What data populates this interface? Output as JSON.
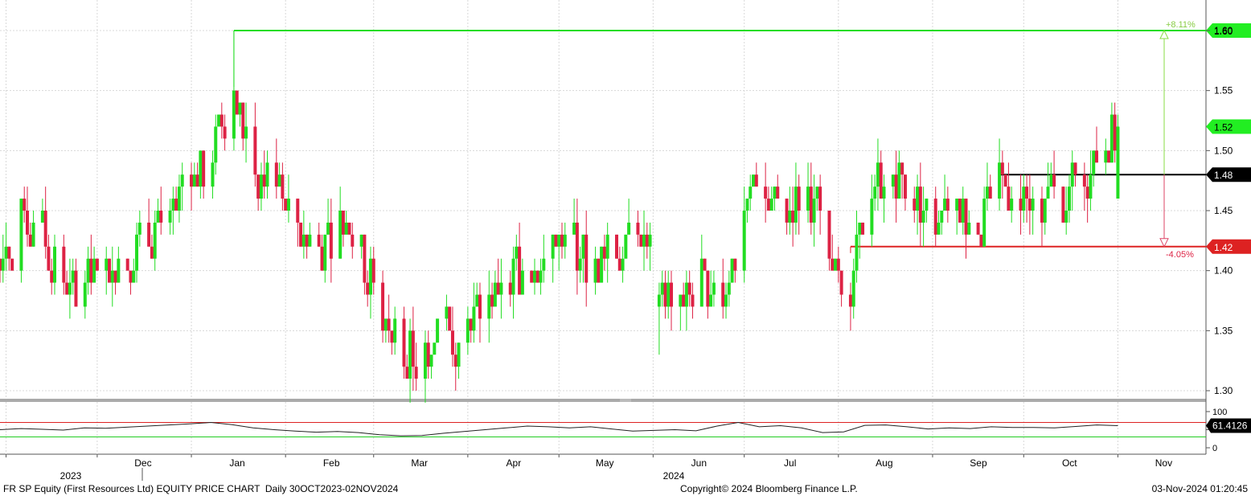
{
  "footer": {
    "left": "FR SP Equity (First Resources Ltd) EQUITY PRICE CHART  Daily 30OCT2023-02NOV2024",
    "center": "Copyright© 2024 Bloomberg Finance L.P.",
    "right": "03-Nov-2024 01:20:45"
  },
  "colors": {
    "up": "#22dd22",
    "down": "#dd2244",
    "grid": "#d8d8d8",
    "resistance": "#22dd22",
    "support": "#dd2222",
    "current": "#000000"
  },
  "chart_data": [
    {
      "type": "candlestick",
      "ylim": [
        1.29,
        1.62
      ],
      "yticks": [
        "1.30",
        "1.35",
        "1.40",
        "1.45",
        "1.50",
        "1.55",
        "1.60"
      ],
      "x_months": [
        "Dec",
        "Jan",
        "Feb",
        "Mar",
        "Apr",
        "May",
        "Jun",
        "Jul",
        "Aug",
        "Sep",
        "Oct",
        "Nov"
      ],
      "x_years": [
        "2023",
        "2024"
      ],
      "levels": [
        {
          "label": "1.60",
          "value": 1.6,
          "start": "2024-01-15",
          "color": "green"
        },
        {
          "label": "1.52",
          "value": 1.52,
          "color": "green"
        },
        {
          "label": "1.48",
          "value": 1.48,
          "start": "2024-09-23",
          "color": "black"
        },
        {
          "label": "1.42",
          "value": 1.42,
          "start": "2024-08-05",
          "color": "red"
        }
      ],
      "annotations": [
        {
          "text": "+8.11%",
          "value": 1.6,
          "color": "green"
        },
        {
          "text": "-4.05%",
          "value": 1.42,
          "color": "red"
        }
      ],
      "close_path": [
        [
          "2023-10-30",
          1.41
        ],
        [
          "2023-11-06",
          1.44
        ],
        [
          "2023-11-13",
          1.42
        ],
        [
          "2023-11-20",
          1.39
        ],
        [
          "2023-11-27",
          1.39
        ],
        [
          "2023-12-04",
          1.4
        ],
        [
          "2023-12-11",
          1.41
        ],
        [
          "2023-12-18",
          1.43
        ],
        [
          "2023-12-25",
          1.44
        ],
        [
          "2024-01-01",
          1.47
        ],
        [
          "2024-01-08",
          1.5
        ],
        [
          "2024-01-15",
          1.55
        ],
        [
          "2024-01-22",
          1.48
        ],
        [
          "2024-01-29",
          1.48
        ],
        [
          "2024-02-05",
          1.43
        ],
        [
          "2024-02-12",
          1.42
        ],
        [
          "2024-02-19",
          1.44
        ],
        [
          "2024-02-26",
          1.42
        ],
        [
          "2024-03-04",
          1.36
        ],
        [
          "2024-03-11",
          1.34
        ],
        [
          "2024-03-18",
          1.33
        ],
        [
          "2024-03-25",
          1.35
        ],
        [
          "2024-04-01",
          1.36
        ],
        [
          "2024-04-08",
          1.38
        ],
        [
          "2024-04-15",
          1.39
        ],
        [
          "2024-04-22",
          1.41
        ],
        [
          "2024-04-29",
          1.43
        ],
        [
          "2024-05-06",
          1.42
        ],
        [
          "2024-05-13",
          1.4
        ],
        [
          "2024-05-20",
          1.42
        ],
        [
          "2024-05-27",
          1.43
        ],
        [
          "2024-06-03",
          1.38
        ],
        [
          "2024-06-10",
          1.38
        ],
        [
          "2024-06-17",
          1.39
        ],
        [
          "2024-06-24",
          1.38
        ],
        [
          "2024-07-01",
          1.44
        ],
        [
          "2024-07-08",
          1.47
        ],
        [
          "2024-07-15",
          1.45
        ],
        [
          "2024-07-22",
          1.47
        ],
        [
          "2024-07-29",
          1.4
        ],
        [
          "2024-08-05",
          1.39
        ],
        [
          "2024-08-12",
          1.47
        ],
        [
          "2024-08-19",
          1.48
        ],
        [
          "2024-08-26",
          1.46
        ],
        [
          "2024-09-02",
          1.44
        ],
        [
          "2024-09-09",
          1.45
        ],
        [
          "2024-09-16",
          1.44
        ],
        [
          "2024-09-23",
          1.47
        ],
        [
          "2024-09-30",
          1.46
        ],
        [
          "2024-10-07",
          1.46
        ],
        [
          "2024-10-14",
          1.46
        ],
        [
          "2024-10-21",
          1.48
        ],
        [
          "2024-10-28",
          1.5
        ],
        [
          "2024-11-01",
          1.52
        ]
      ]
    },
    {
      "type": "line",
      "name": "RSI",
      "yticks": [
        "100",
        "50",
        "0"
      ],
      "ylim": [
        0,
        100
      ],
      "reference_lines": [
        70,
        30
      ],
      "current_label": "61.4126",
      "values": [
        50,
        53,
        51,
        49,
        55,
        54,
        57,
        60,
        63,
        66,
        70,
        64,
        55,
        50,
        46,
        43,
        45,
        42,
        36,
        33,
        34,
        40,
        45,
        50,
        55,
        60,
        58,
        55,
        58,
        52,
        46,
        48,
        50,
        47,
        60,
        70,
        58,
        61,
        55,
        42,
        44,
        62,
        63,
        58,
        52,
        55,
        53,
        58,
        56,
        56,
        55,
        59,
        63,
        61
      ]
    }
  ]
}
